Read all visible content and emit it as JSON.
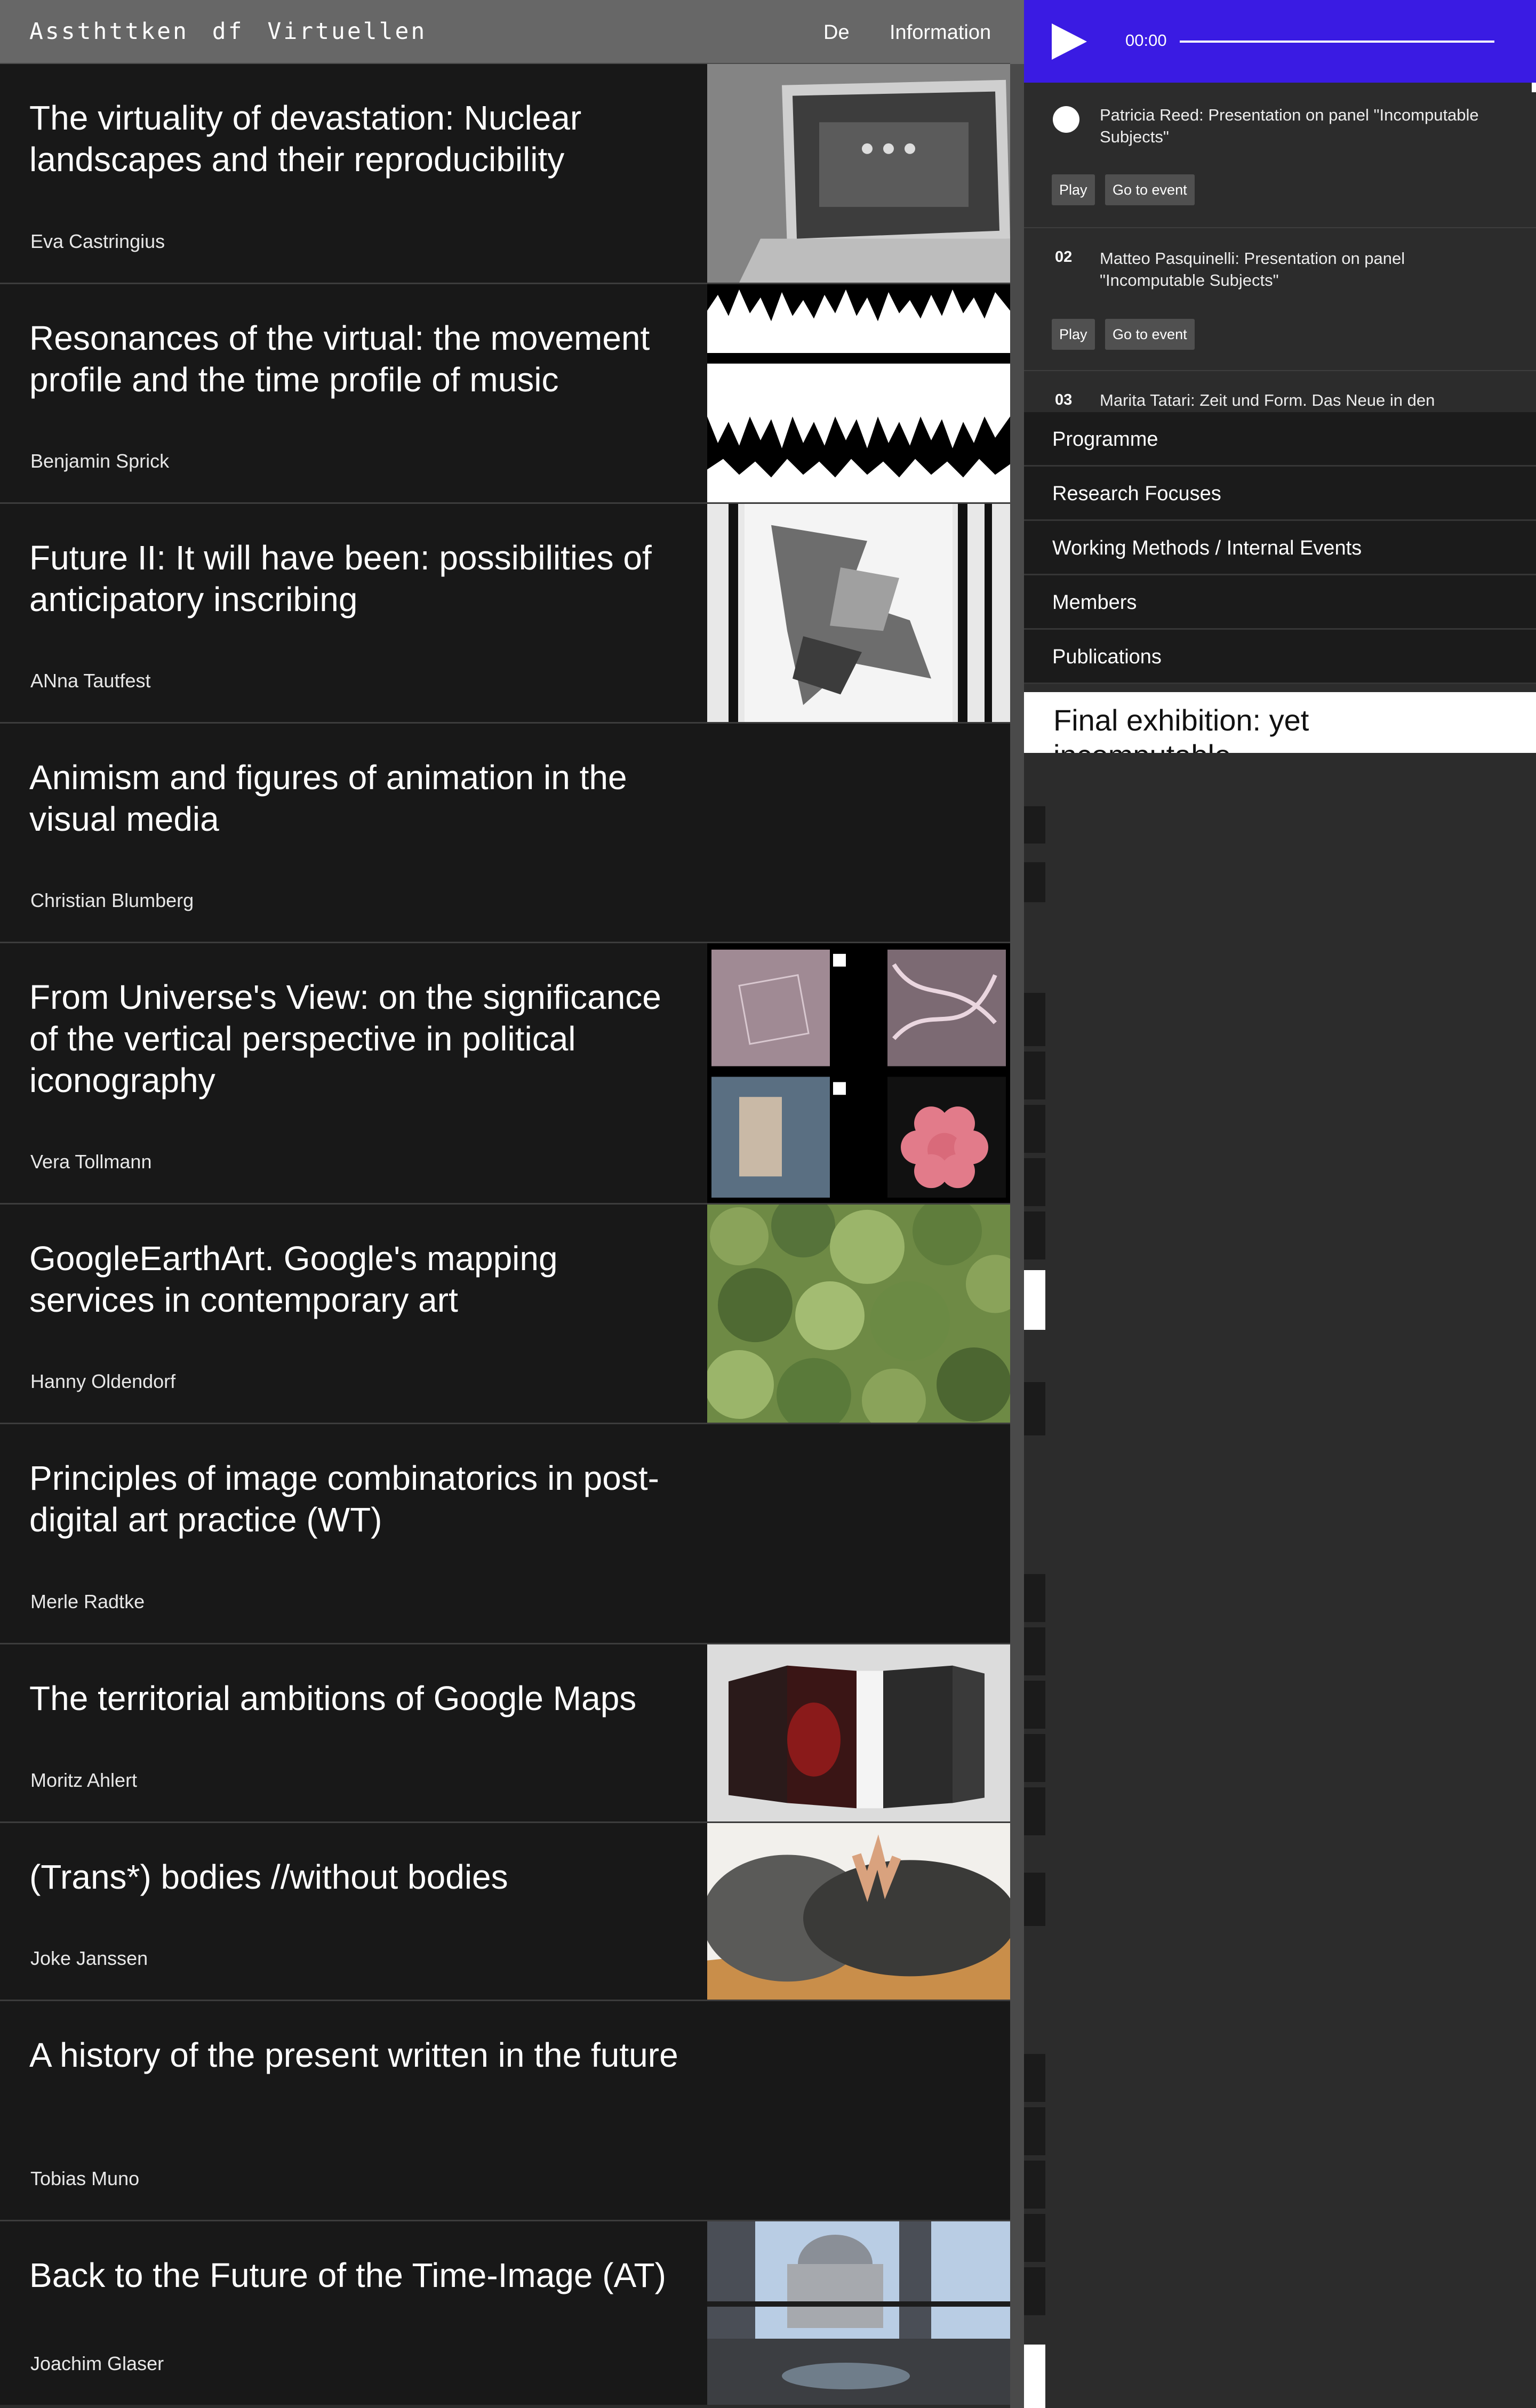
{
  "header": {
    "site_title": "Assthttken df  Virtuellen",
    "nav": [
      {
        "label": "De"
      },
      {
        "label": "Information"
      }
    ]
  },
  "items": [
    {
      "title": "The virtuality of devastation: Nuclear landscapes and their reproducibility",
      "author": "Eva Castringius",
      "thumbnail": "laptop-photo"
    },
    {
      "title": "Resonances of the virtual: the movement profile and the time profile of music",
      "author": "Benjamin Sprick",
      "thumbnail": "waveform"
    },
    {
      "title": "Future II: It will have been: possibilities of anticipatory inscribing",
      "author": "ANna Tautfest",
      "thumbnail": "grid-figure"
    },
    {
      "title": "Animism and figures of animation in the visual media",
      "author": "Christian Blumberg",
      "thumbnail": ""
    },
    {
      "title": "From Universe's View: on the significance of the vertical perspective in political iconography",
      "author": "Vera Tollmann",
      "thumbnail": "aerial-grid"
    },
    {
      "title": "GoogleEarthArt. Google's mapping services in contemporary art",
      "author": "Hanny Oldendorf",
      "thumbnail": "forest-aerial"
    },
    {
      "title": "Principles of image combinatorics in post-digital art practice (WT)",
      "author": "Merle Radtke",
      "thumbnail": ""
    },
    {
      "title": "The territorial ambitions of Google Maps",
      "author": "Moritz Ahlert",
      "thumbnail": "map-book"
    },
    {
      "title": "(Trans*) bodies //without bodies",
      "author": "Joke Janssen",
      "thumbnail": "body-photo"
    },
    {
      "title": "A history of the present written in the future",
      "author": "Tobias Muno",
      "thumbnail": ""
    },
    {
      "title": "Back to the Future of the Time-Image (AT)",
      "author": "Joachim Glaser",
      "thumbnail": "cathedral-photo"
    }
  ],
  "player": {
    "time": "00:00",
    "progress": 0,
    "accent": "#3a1be3"
  },
  "playlist": [
    {
      "number": "",
      "title": "Patricia Reed: Presentation on panel \"Incomputable Subjects\"",
      "play_label": "Play",
      "event_label": "Go to event"
    },
    {
      "number": "02",
      "title": "Matteo Pasquinelli: Presentation on panel \"Incomputable Subjects\"",
      "play_label": "Play",
      "event_label": "Go to event"
    },
    {
      "number": "03",
      "title": "Marita Tatari: Zeit und Form. Das Neue in den"
    }
  ],
  "menu": [
    {
      "label": "Programme"
    },
    {
      "label": "Research Focuses"
    },
    {
      "label": "Working Methods / Internal Events"
    },
    {
      "label": "Members"
    },
    {
      "label": "Publications"
    }
  ],
  "feature": {
    "title": "Final exhibition: yet incomputable"
  }
}
